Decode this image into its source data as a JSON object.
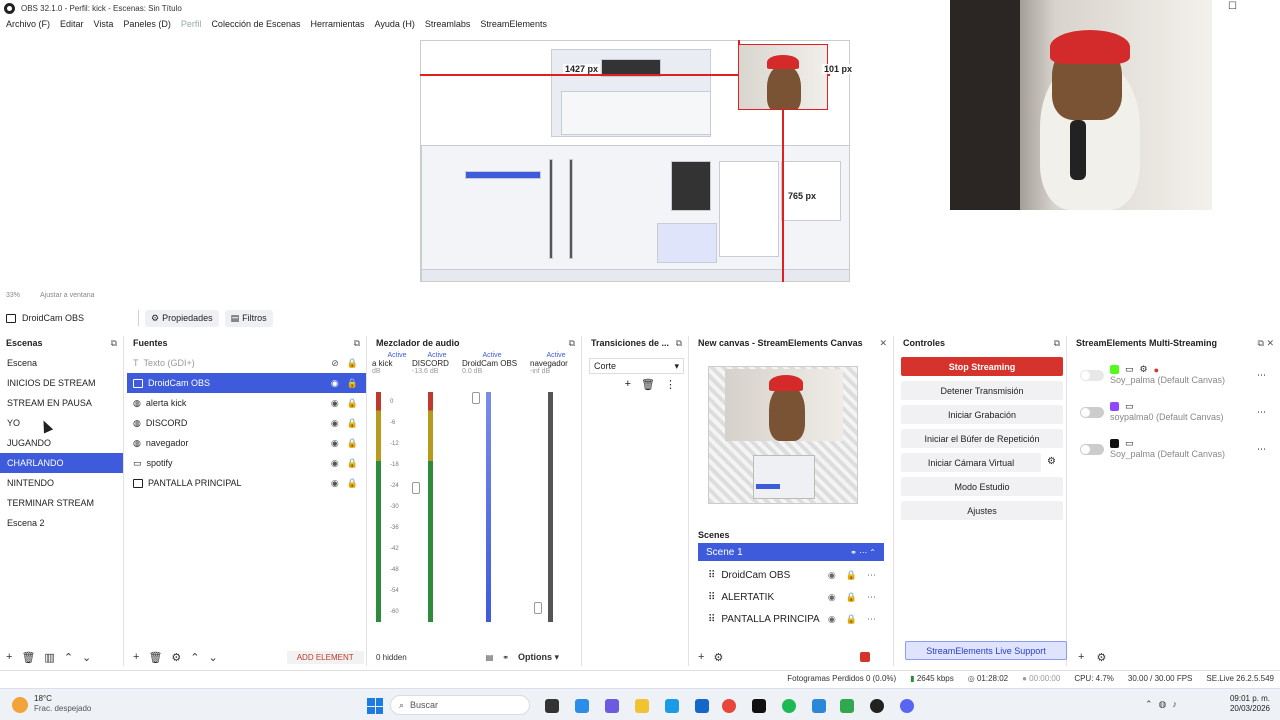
{
  "window": {
    "title": "OBS 32.1.0 - Perfil: kick - Escenas: Sin Título",
    "minimize": "—",
    "maximize": "☐"
  },
  "menu": {
    "items": [
      "Archivo (F)",
      "Editar",
      "Vista",
      "Paneles (D)",
      "Perfil",
      "Colección de Escenas",
      "Herramientas",
      "Ayuda (H)",
      "Streamlabs",
      "StreamElements"
    ]
  },
  "preview": {
    "labels": {
      "width_px": "1427 px",
      "height_px": "101 px",
      "bottom_px": "765 px"
    },
    "zoom": "33%",
    "fit_label": "Ajustar a ventana"
  },
  "source_toolbar": {
    "selected_source": "DroidCam OBS",
    "properties": "Propiedades",
    "filters": "Filtros"
  },
  "scenes": {
    "title": "Escenas",
    "items": [
      "Escena",
      "INICIOS DE STREAM",
      "STREAM EN PAUSA",
      "YO",
      "JUGANDO",
      "CHARLANDO",
      "NINTENDO",
      "TERMINAR STREAM",
      "Escena 2"
    ],
    "selected_index": 5
  },
  "sources": {
    "title": "Fuentes",
    "items": [
      "Texto (GDI+)",
      "DroidCam OBS",
      "alerta kick",
      "DISCORD",
      "navegador",
      "spotify",
      "PANTALLA PRINCIPAL"
    ],
    "selected_index": 1,
    "add_element": "ADD ELEMENT"
  },
  "mixer": {
    "title": "Mezclador de audio",
    "channels": [
      {
        "name": "a kick",
        "status": "Active",
        "db": "dB"
      },
      {
        "name": "DISCORD",
        "status": "Active",
        "db": "-13.6 dB"
      },
      {
        "name": "DroidCam OBS",
        "status": "Active",
        "db": "0.0 dB"
      },
      {
        "name": "navegador",
        "status": "Active",
        "db": "-inf dB"
      }
    ],
    "scale": [
      "0",
      "-6",
      "-12",
      "-18",
      "-24",
      "-30",
      "-36",
      "-42",
      "-48",
      "-54",
      "-60"
    ],
    "hidden": "0 hidden",
    "options": "Options"
  },
  "transitions": {
    "title": "Transiciones de ...",
    "value": "Corte"
  },
  "canvas": {
    "title": "New canvas - StreamElements Canvas",
    "scenes_label": "Scenes",
    "scene_name": "Scene 1",
    "items": [
      "DroidCam OBS",
      "ALERTATIK",
      "PANTALLA PRINCIPA"
    ]
  },
  "controls": {
    "title": "Controles",
    "buttons": [
      "Stop Streaming",
      "Detener Transmisión",
      "Iniciar Grabación",
      "Iniciar el Búfer de Repetición",
      "Iniciar Cámara Virtual",
      "Modo Estudio",
      "Ajustes"
    ],
    "support": "StreamElements Live Support"
  },
  "multistream": {
    "title": "StreamElements Multi-Streaming",
    "rows": [
      {
        "account": "Soy_palma (Default Canvas)",
        "color": "#53fc18"
      },
      {
        "account": "soypalma0 (Default Canvas)",
        "color": "#9146ff"
      },
      {
        "account": "Soy_palma (Default Canvas)",
        "color": "#111111"
      }
    ]
  },
  "status": {
    "dropped": "Fotogramas Perdidos 0 (0.0%)",
    "kbps": "2645 kbps",
    "live_time": "01:28:02",
    "rec_time": "00:00:00",
    "cpu": "CPU: 4.7%",
    "fps": "30.00 / 30.00 FPS",
    "version": "SE.Live 26.2.5.549"
  },
  "taskbar": {
    "temp": "18°C",
    "weather": "Frac. despejado",
    "search": "Buscar",
    "time": "09:01 p. m.",
    "date": "20/03/2026"
  }
}
